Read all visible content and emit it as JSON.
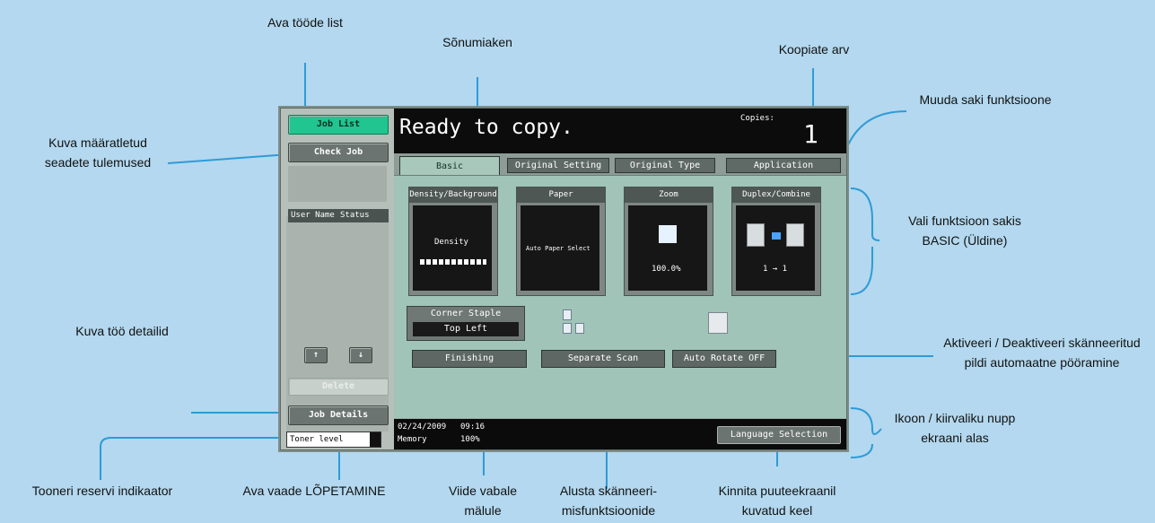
{
  "callouts": {
    "job_list": "Ava tööde list",
    "message_window": "Sõnumiaken",
    "copies": "Koopiate arv",
    "change_tab": "Muuda saki funktsioone",
    "show_results_1": "Kuva määratletud",
    "show_results_2": "seadete tulemused",
    "select_func_1": "Vali funktsioon sakis",
    "select_func_2": "BASIC (Üldine)",
    "auto_rotate_1": "Aktiveeri / Deaktiveeri skänneeritud",
    "auto_rotate_2": "pildi automaatne pööramine",
    "job_details": "Kuva töö detailid",
    "icon_shortcut_1": "Ikoon / kiirvaliku nupp",
    "icon_shortcut_2": "ekraani alas",
    "toner": "Tooneri reservi indikaator",
    "finishing": "Ava vaade LÕPETAMINE",
    "memory_1": "Viide vabale",
    "memory_2": "mälule",
    "separate_scan_1": "Alusta skänneeri-",
    "separate_scan_2": "misfunktsioonide",
    "language_1": "Kinnita puuteekraanil",
    "language_2": "kuvatud keel"
  },
  "screen": {
    "left": {
      "job_list": "Job List",
      "check_job": "Check Job",
      "status_col1": "User Name",
      "status_col2": "Status",
      "up": "↑",
      "down": "↓",
      "delete": "Delete",
      "job_details": "Job Details",
      "toner": "Toner level"
    },
    "header": {
      "message": "Ready to copy.",
      "copies_label": "Copies:",
      "copies_value": "1"
    },
    "tabs": [
      "Basic",
      "Original Setting",
      "Original Type",
      "Application"
    ],
    "functions": {
      "density_title": "Density/Background",
      "density_label": "Density",
      "paper_title": "Paper",
      "paper_value": "Auto Paper Select",
      "zoom_title": "Zoom",
      "zoom_value": "100.0%",
      "duplex_title": "Duplex/Combine",
      "duplex_value": "1 → 1"
    },
    "finishing_box": {
      "title": "Corner Staple",
      "value": "Top Left"
    },
    "buttons": {
      "finishing": "Finishing",
      "separate_scan": "Separate Scan",
      "auto_rotate": "Auto Rotate OFF"
    },
    "footer": {
      "date": "02/24/2009",
      "time": "09:16",
      "memory_label": "Memory",
      "memory_value": "100%",
      "language": "Language Selection"
    }
  }
}
